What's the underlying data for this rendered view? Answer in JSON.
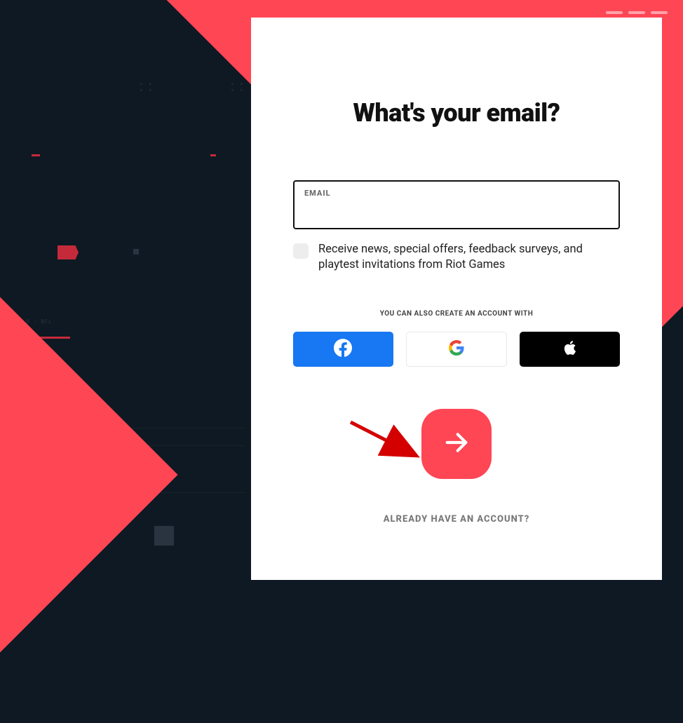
{
  "card": {
    "title": "What's your email?",
    "email_label": "EMAIL",
    "email_value": "",
    "checkbox_label": "Receive news, special offers, feedback surveys, and playtest invitations from Riot Games",
    "social_heading": "YOU CAN ALSO CREATE AN ACCOUNT WITH",
    "already_link": "ALREADY HAVE AN ACCOUNT?"
  },
  "deco": {
    "text": "OTRCOL\n D - BFL"
  },
  "colors": {
    "accent": "#ff4655",
    "dark": "#0f1923",
    "facebook": "#1877f2"
  }
}
